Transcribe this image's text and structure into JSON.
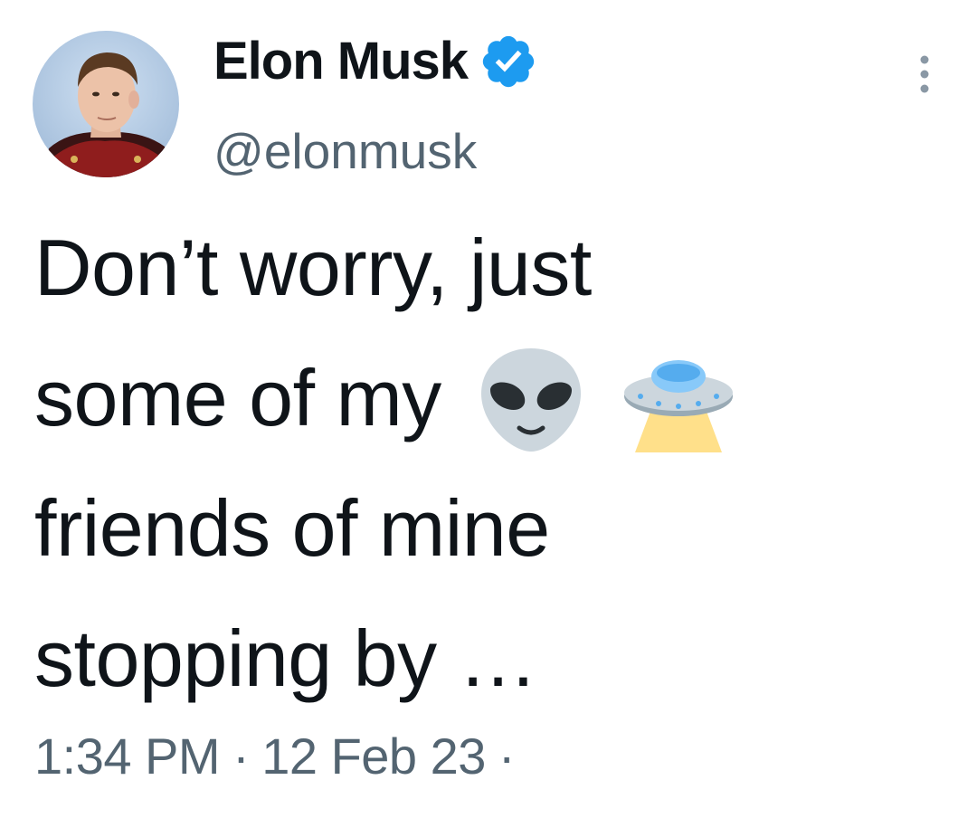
{
  "author": {
    "display_name": "Elon Musk",
    "handle": "@elonmusk",
    "verified": true,
    "verified_color": "#1d9bf0"
  },
  "tweet": {
    "lines": [
      "Don’t worry, just",
      "some of my",
      "friends of mine",
      "stopping by …"
    ],
    "emojis": [
      "alien-emoji",
      "ufo-emoji"
    ]
  },
  "meta": {
    "time": "1:34 PM",
    "separator": "·",
    "date": "12 Feb 23",
    "trailing_separator": "·"
  },
  "colors": {
    "text": "#0f1419",
    "secondary_text": "#536471",
    "background": "#ffffff"
  }
}
